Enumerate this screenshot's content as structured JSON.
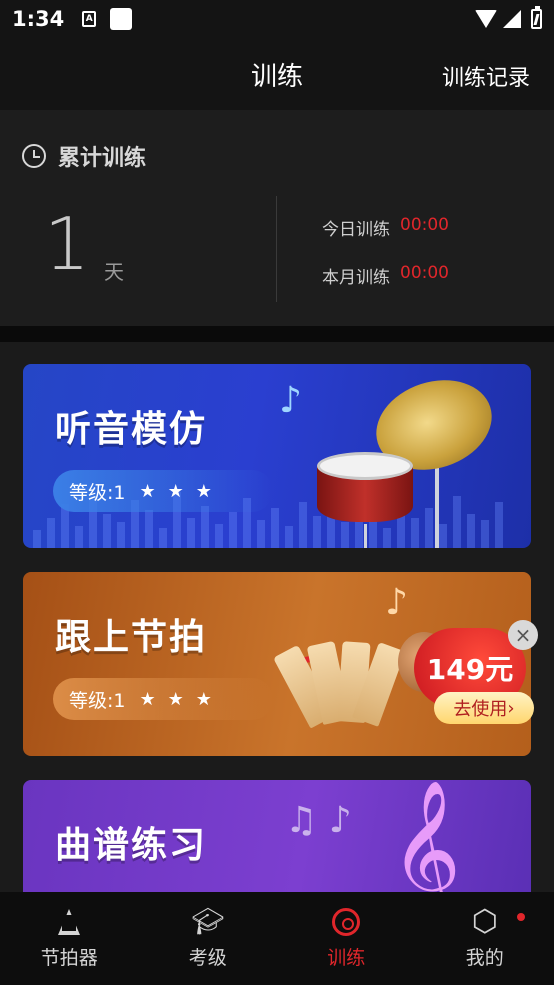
{
  "status_bar": {
    "time": "1:34",
    "indicator_a": "A"
  },
  "header": {
    "title": "训练",
    "history_link": "训练记录"
  },
  "stats": {
    "title": "累计训练",
    "days_value": "1",
    "days_unit": "天",
    "today_label": "今日训练",
    "today_value": "00:00",
    "month_label": "本月训练",
    "month_value": "00:00"
  },
  "cards": [
    {
      "title": "听音模仿",
      "level": "等级:1",
      "stars": "★",
      "note": "♪"
    },
    {
      "title": "跟上节拍",
      "level": "等级:1",
      "stars": "★",
      "note": "♪"
    },
    {
      "title": "曲谱练习",
      "treble": "𝄞",
      "notes": "♫ ♪"
    }
  ],
  "coupon": {
    "amount": "149元",
    "button": "去使用",
    "close": "×",
    "arrow": "›"
  },
  "nav": {
    "items": [
      {
        "label": "节拍器",
        "icon": "metronome-icon"
      },
      {
        "label": "考级",
        "icon": "graduation-cap-icon"
      },
      {
        "label": "训练",
        "icon": "target-icon",
        "active": true
      },
      {
        "label": "我的",
        "icon": "hexagon-settings-icon",
        "badge": true
      }
    ]
  },
  "colors": {
    "accent": "#e0262b",
    "background": "#141414"
  }
}
